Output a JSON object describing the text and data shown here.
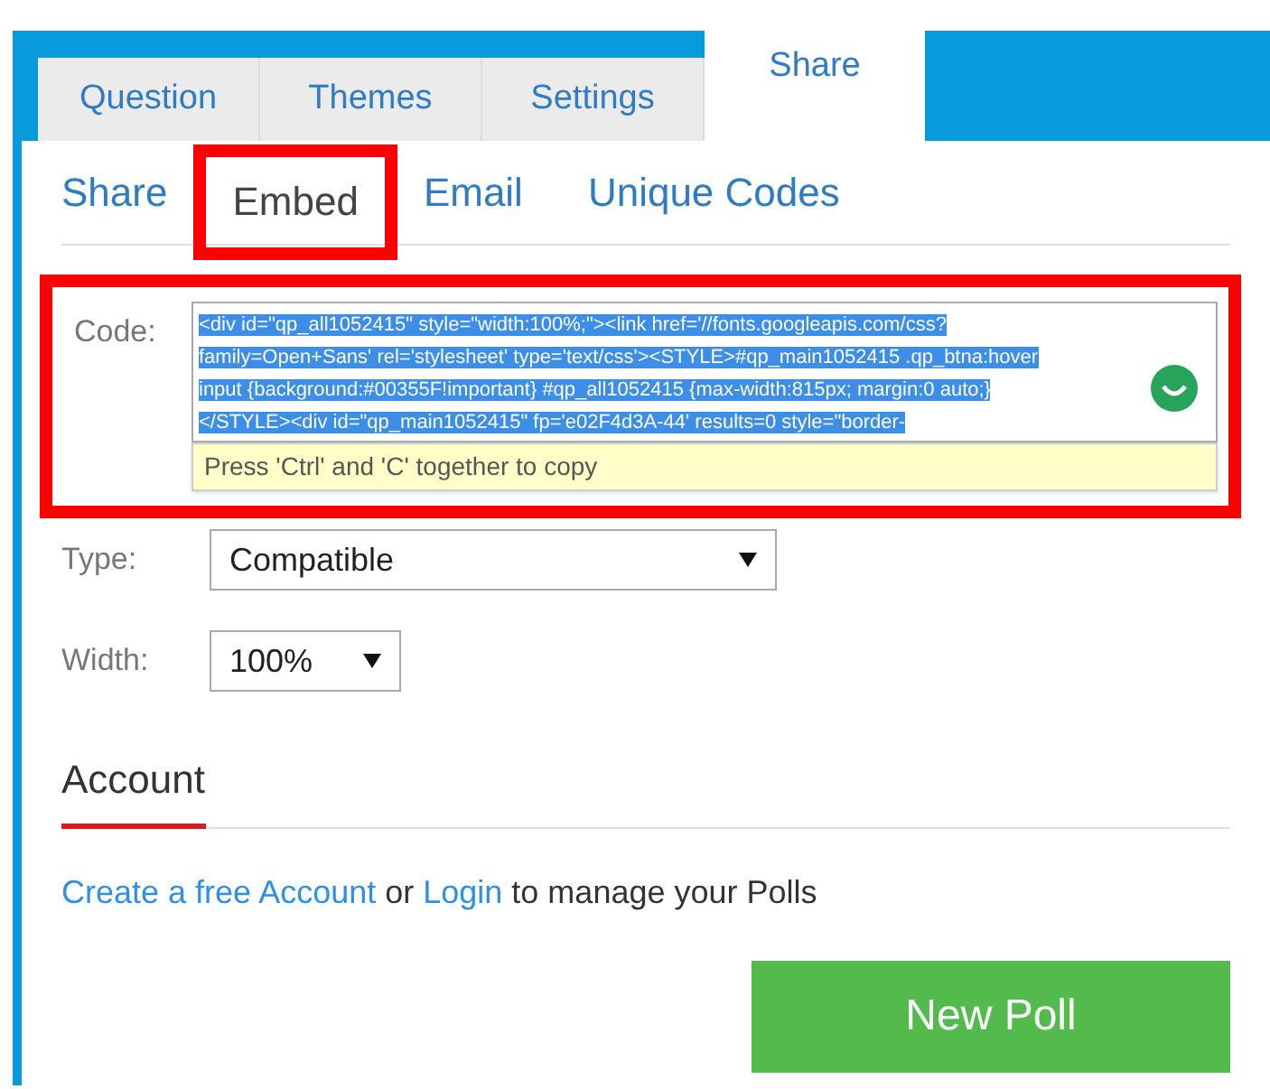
{
  "tabs": [
    {
      "label": "Question",
      "selected": false
    },
    {
      "label": "Themes",
      "selected": false
    },
    {
      "label": "Settings",
      "selected": false
    },
    {
      "label": "Share",
      "selected": true
    }
  ],
  "subtabs": [
    {
      "label": "Share",
      "selected": false,
      "highlighted": false
    },
    {
      "label": "Embed",
      "selected": true,
      "highlighted": true
    },
    {
      "label": "Email",
      "selected": false,
      "highlighted": false
    },
    {
      "label": "Unique Codes",
      "selected": false,
      "highlighted": false
    }
  ],
  "code": {
    "label": "Code:",
    "highlighted": true,
    "selected": true,
    "value_lines": [
      "<div id=\"qp_all1052415\" style=\"width:100%;\"><link href='//fonts.googleapis.com/css?",
      "family=Open+Sans' rel='stylesheet' type='text/css'><STYLE>#qp_main1052415 .qp_btna:hover",
      "input {background:#00355F!important} #qp_all1052415 {max-width:815px; margin:0 auto;}",
      "</STYLE><div id=\"qp_main1052415\" fp='e02F4d3A-44' results=0 style=\"border-"
    ],
    "tooltip": "Press 'Ctrl' and 'C' together to copy"
  },
  "type": {
    "label": "Type:",
    "value": "Compatible"
  },
  "width": {
    "label": "Width:",
    "value": "100%"
  },
  "account": {
    "heading": "Account",
    "create_link": "Create a free Account",
    "or": "or",
    "login_link": "Login",
    "rest": "to manage your Polls"
  },
  "new_poll_button": "New Poll"
}
